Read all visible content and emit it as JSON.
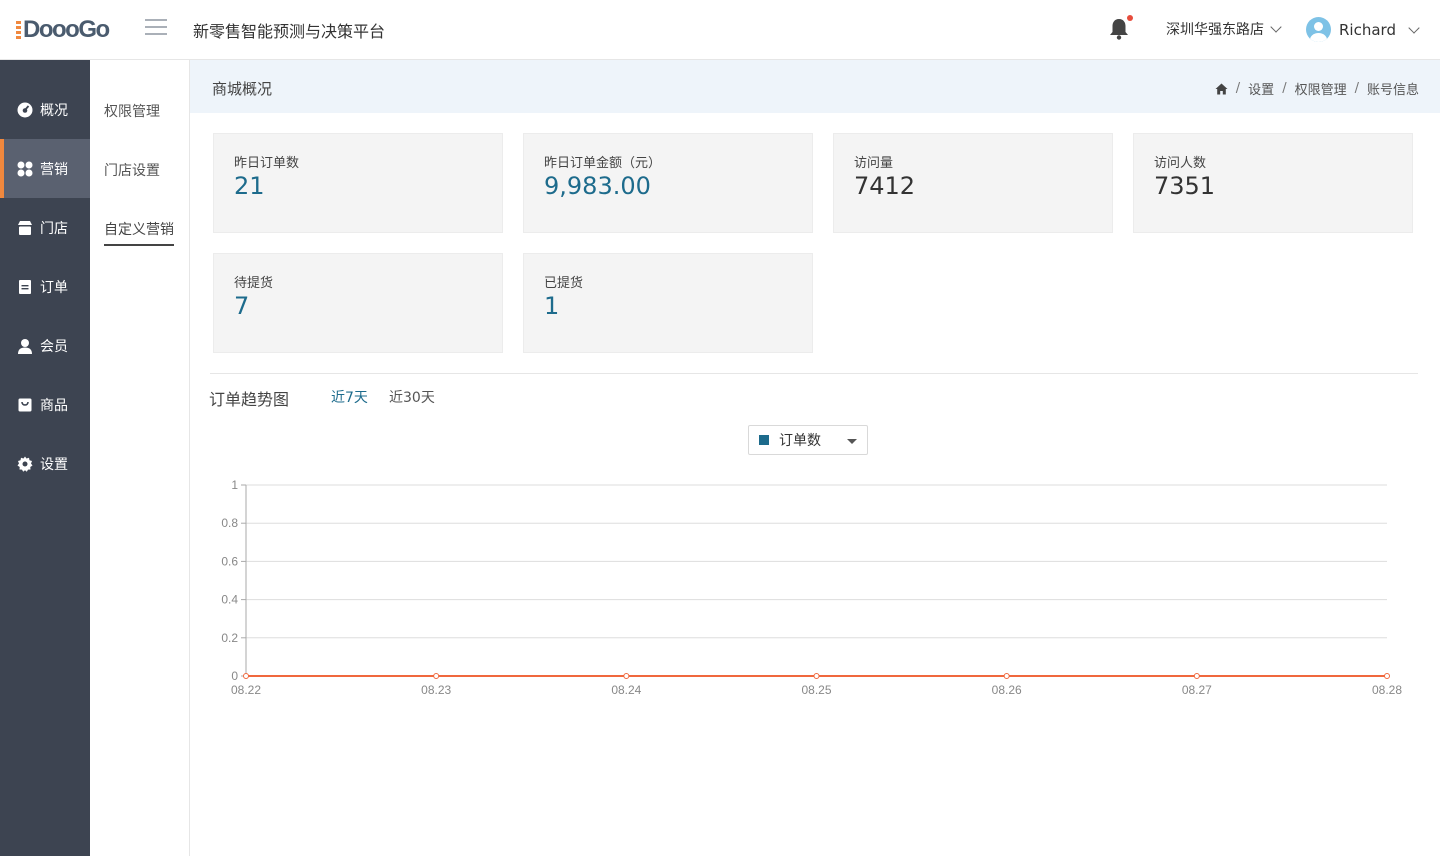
{
  "header": {
    "logo_text": "DoooGo",
    "app_title": "新零售智能预测与决策平台",
    "store": "深圳华强东路店",
    "user": "Richard"
  },
  "sidebar": {
    "items": [
      {
        "label": "概况",
        "icon": "dashboard-icon"
      },
      {
        "label": "营销",
        "icon": "apps-icon"
      },
      {
        "label": "门店",
        "icon": "store-icon"
      },
      {
        "label": "订单",
        "icon": "order-icon"
      },
      {
        "label": "会员",
        "icon": "user-icon"
      },
      {
        "label": "商品",
        "icon": "product-icon"
      },
      {
        "label": "设置",
        "icon": "gear-icon"
      }
    ],
    "active_index": 1
  },
  "subnav": {
    "items": [
      "权限管理",
      "门店设置",
      "自定义营销"
    ],
    "active_index": 2
  },
  "page": {
    "title": "商城概况",
    "breadcrumb": [
      "设置",
      "权限管理",
      "账号信息"
    ]
  },
  "stats": [
    {
      "label": "昨日订单数",
      "value": "21"
    },
    {
      "label": "昨日订单金额（元）",
      "value": "9,983.00"
    },
    {
      "label": "访问量",
      "value": "7412"
    },
    {
      "label": "访问人数",
      "value": "7351"
    },
    {
      "label": "待提货",
      "value": "7"
    },
    {
      "label": "已提货",
      "value": "1"
    }
  ],
  "trend": {
    "title": "订单趋势图",
    "ranges": [
      "近7天",
      "近30天"
    ],
    "active_range": 0,
    "series_select": "订单数"
  },
  "colors": {
    "accent": "#1d6b8c",
    "sidebar": "#3d4451",
    "highlight": "#f0883e",
    "line": "#f0683e"
  },
  "chart_data": {
    "type": "line",
    "categories": [
      "08.22",
      "08.23",
      "08.24",
      "08.25",
      "08.26",
      "08.27",
      "08.28"
    ],
    "series": [
      {
        "name": "订单数",
        "values": [
          0,
          0,
          0,
          0,
          0,
          0,
          0
        ]
      }
    ],
    "yticks": [
      "0",
      "0.2",
      "0.4",
      "0.6",
      "0.8",
      "1"
    ],
    "ylim": [
      0,
      1
    ],
    "grid": true
  }
}
